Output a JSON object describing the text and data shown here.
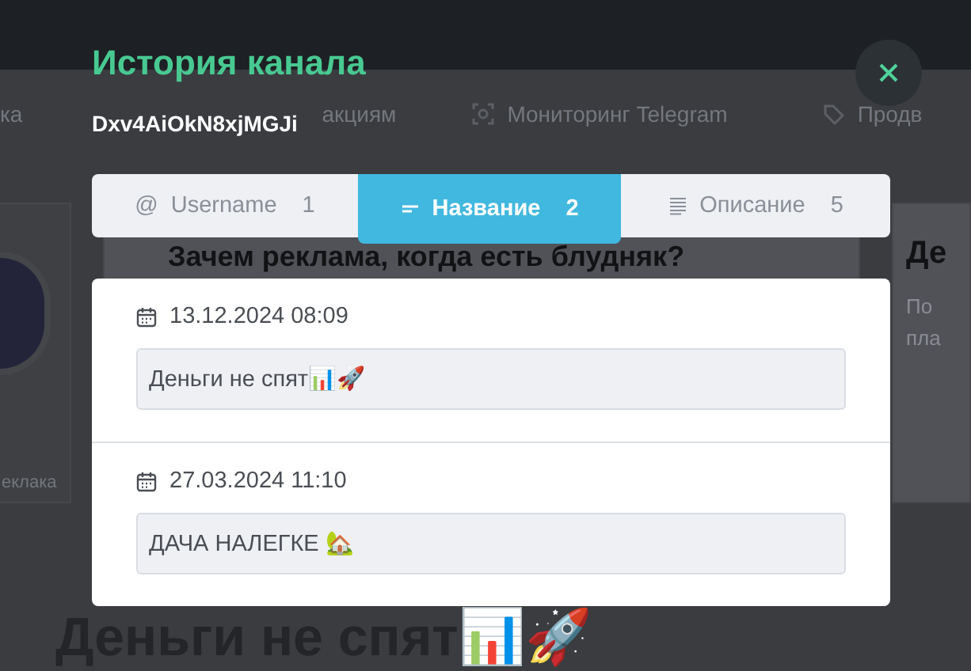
{
  "background_page": {
    "nav_items": [
      {
        "label": "ка"
      },
      {
        "label": "акциям"
      },
      {
        "label": "Мониторинг Telegram"
      },
      {
        "label": "Продв"
      }
    ],
    "left_card": {
      "caption": "еклака"
    },
    "middle_card": {
      "heading": "Зачем реклама, когда есть блудняк?"
    },
    "right_card": {
      "heading": "Де",
      "lines": [
        "По",
        "пла"
      ]
    },
    "page_heading": "Деньги не спят📊🚀"
  },
  "modal": {
    "title": "История канала",
    "subtitle": "Dxv4AiOkN8xjMGJi",
    "tabs": [
      {
        "label": "Username",
        "count": "1",
        "icon_text": "@",
        "selected": false
      },
      {
        "label": "Название",
        "count": "2",
        "selected": true
      },
      {
        "label": "Описание",
        "count": "5",
        "selected": false
      }
    ],
    "entries": [
      {
        "date": "13.12.2024 08:09",
        "value": "Деньги не спят📊🚀"
      },
      {
        "date": "27.03.2024 11:10",
        "value": "ДАЧА НАЛЕГКЕ 🏡"
      }
    ]
  }
}
